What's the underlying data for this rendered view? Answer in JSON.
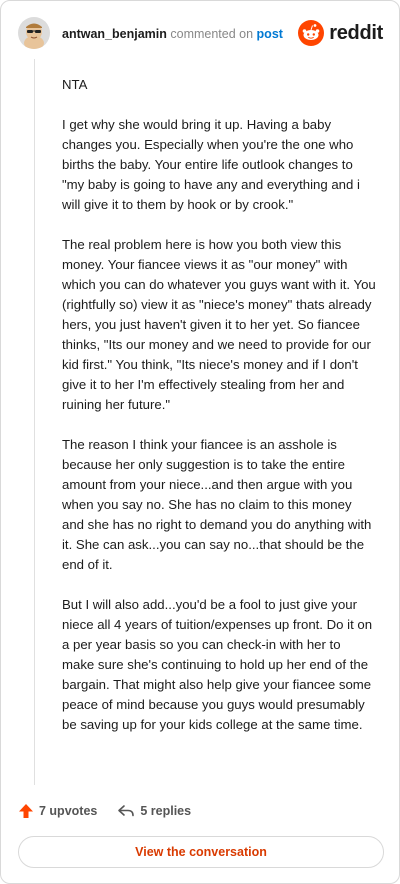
{
  "header": {
    "username": "antwan_benjamin",
    "commented_on": "commented on",
    "post_link": "post",
    "brand": "reddit"
  },
  "comment": {
    "paragraphs": [
      "NTA",
      "I get why she would bring it up. Having a baby changes you. Especially when you're the one who births the baby. Your entire life outlook changes to \"my baby is going to have any and everything and i will give it to them by hook or by crook.\"",
      "The real problem here is how you both view this money. Your fiancee views it as \"our money\" with which you can do whatever you guys want with it. You (rightfully so) view it as \"niece's money\" thats already hers, you just haven't given it to her yet. So fiancee thinks, \"Its our money and we need to provide for our kid first.\" You think, \"Its niece's money and if I don't give it to her I'm effectively stealing from her and ruining her future.\"",
      "The reason I think your fiancee is an asshole is because her only suggestion is to take the entire amount from your niece...and then argue with you when you say no. She has no claim to this money and she has no right to demand you do anything with it. She can ask...you can say no...that should be the end of it.",
      "But I will also add...you'd be a fool to just give your niece all 4 years of tuition/expenses up front. Do it on a per year basis so you can check-in with her to make sure she's continuing to hold up her end of the bargain. That might also help give your fiancee some peace of mind because you guys would presumably be saving up for your kids college at the same time."
    ]
  },
  "actions": {
    "upvotes": "7 upvotes",
    "replies": "5 replies"
  },
  "cta": {
    "label": "View the conversation"
  },
  "colors": {
    "brand_orange": "#ff4500",
    "link_blue": "#0079d3",
    "cta_text": "#d93a00"
  }
}
